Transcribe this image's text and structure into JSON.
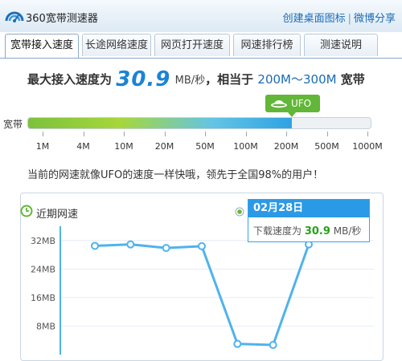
{
  "window": {
    "title": "360宽带测速器",
    "links": [
      "创建桌面图标",
      "微博分享"
    ],
    "separator": "|"
  },
  "tabs": [
    {
      "label": "宽带接入速度",
      "active": true
    },
    {
      "label": "长途网络速度",
      "active": false
    },
    {
      "label": "网页打开速度",
      "active": false
    },
    {
      "label": "网速排行榜",
      "active": false
    },
    {
      "label": "测速说明",
      "active": false
    }
  ],
  "speed": {
    "prefix": "最大接入速度为",
    "value": "30.9",
    "unit": "MB/秒",
    "middle": "，相当于",
    "range": "200M～300M",
    "suffix": "宽带"
  },
  "gauge": {
    "label": "宽带",
    "badge": "UFO",
    "fill_fraction": 0.77,
    "ticks": [
      "1M",
      "4M",
      "10M",
      "20M",
      "50M",
      "100M",
      "200M",
      "500M",
      "1000M"
    ],
    "colors": {
      "green": "#7cc13c",
      "blue": "#2fa3e3",
      "badge": "#62b638"
    }
  },
  "message": "当前的网速就像UFO的速度一样快哦，领先于全国98%的用户！",
  "recent": {
    "title": "近期网速",
    "tooltip": {
      "date": "02月28日",
      "label": "下载速度为",
      "value": "30.9",
      "unit": "MB/秒"
    }
  },
  "chart_data": {
    "type": "line",
    "y_ticks": [
      "32MB",
      "24MB",
      "16MB",
      "8MB"
    ],
    "ylim": [
      0,
      36
    ],
    "values": [
      30.5,
      30.9,
      29.9,
      30.4,
      3.0,
      2.7,
      30.9
    ],
    "color": "#4fb3ec"
  }
}
